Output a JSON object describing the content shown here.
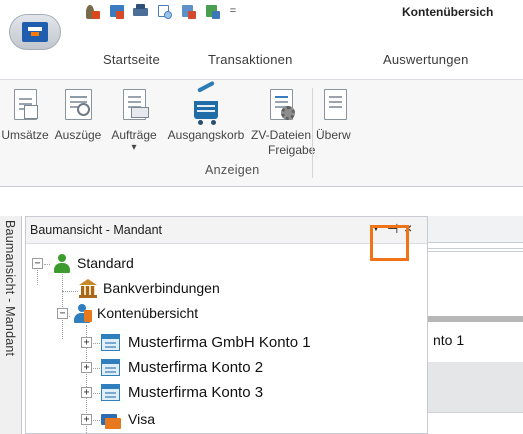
{
  "window": {
    "title": "Kontenübersich"
  },
  "quick_access": {
    "icons": [
      {
        "name": "user-lock-icon",
        "color": "#7a6a4a",
        "accent": "#d84a1b"
      },
      {
        "name": "close-table-icon",
        "color": "#3b7bbf",
        "accent": "#d64a2a"
      },
      {
        "name": "print-icon",
        "color": "#4b6f99",
        "accent": "#2f4f77"
      },
      {
        "name": "print-preview-icon",
        "color": "#4a7fbf",
        "accent": "#9ec3ea"
      },
      {
        "name": "export-icon",
        "color": "#5e8fc6",
        "accent": "#d34a2c"
      },
      {
        "name": "table-settings-icon",
        "color": "#4a9e4f",
        "accent": "#3c78b8"
      }
    ],
    "dropdown_glyph": "="
  },
  "ribbon": {
    "tabs": [
      "Startseite",
      "Transaktionen",
      "Auswertungen"
    ],
    "buttons": [
      {
        "label": "Umsätze",
        "icon": "turnover-document-icon"
      },
      {
        "label": "Auszüge",
        "icon": "statement-search-icon"
      },
      {
        "label": "Aufträge",
        "icon": "orders-document-icon",
        "dropdown": "▾"
      },
      {
        "label": "Ausgangskorb",
        "icon": "outbox-basket-icon"
      },
      {
        "label_line1": "ZV-Dateien",
        "label_line2": "Freigabe",
        "icon": "payment-file-release-icon"
      },
      {
        "label": "Überw",
        "icon": "transfer-document-icon"
      }
    ],
    "group_label": "Anzeigen"
  },
  "side_tab": {
    "label": "Baumansicht - Mandant"
  },
  "panel": {
    "title": "Baumansicht - Mandant",
    "dropdown_glyph": "▼",
    "pin_glyph": "⊣",
    "close_glyph": "×",
    "highlight_color": "#f07317"
  },
  "tree": {
    "root": {
      "label": "Standard",
      "toggle": "−",
      "icon": "client-person-icon"
    },
    "bank": {
      "label": "Bankverbindungen",
      "icon": "bank-building-icon"
    },
    "overview": {
      "label": "Kontenübersicht",
      "toggle": "−",
      "icon": "account-overview-icon"
    },
    "accounts": [
      {
        "label": "Musterfirma GmbH Konto 1",
        "toggle": "+",
        "icon": "account-icon"
      },
      {
        "label": "Musterfirma Konto 2",
        "toggle": "+",
        "icon": "account-icon"
      },
      {
        "label": "Musterfirma Konto 3",
        "toggle": "+",
        "icon": "account-icon"
      },
      {
        "label": "Visa",
        "toggle": "+",
        "icon": "credit-card-icon"
      }
    ]
  },
  "document": {
    "visible_text": "nto 1"
  }
}
